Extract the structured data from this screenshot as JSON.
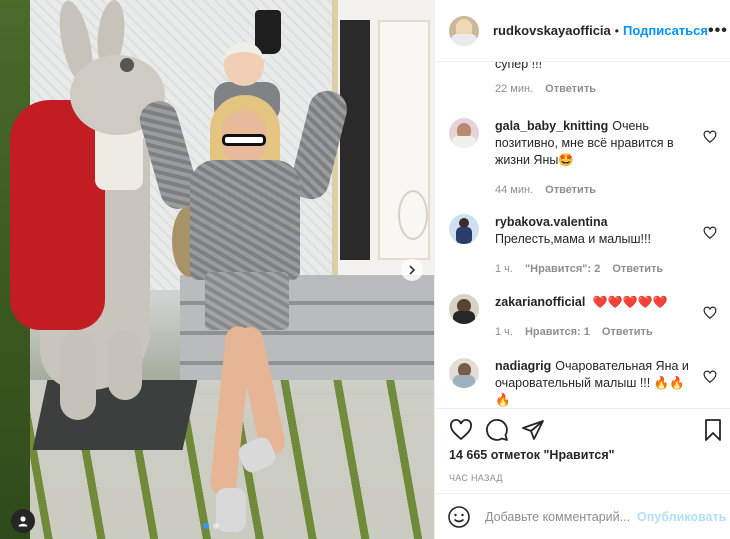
{
  "post": {
    "image_alt": "",
    "carousel": {
      "dots": 2,
      "active": 0
    },
    "icons": {
      "next": "chevron-right-icon",
      "tag": "user-tag-icon"
    }
  },
  "header": {
    "username": "rudkovskayaofficia",
    "separator": "•",
    "follow_label": "Подписаться",
    "more_label": "•••"
  },
  "comments": [
    {
      "user": "",
      "text": "супер !!!",
      "time": "22 мин.",
      "likes": "",
      "reply": "Ответить",
      "has_avatar": false
    },
    {
      "user": "gala_baby_knitting",
      "text": "Очень позитивно, мне всё нравится в жизни Яны🤩",
      "time": "44 мин.",
      "likes": "",
      "reply": "Ответить",
      "has_avatar": true
    },
    {
      "user": "rybakova.valentina",
      "text": "Прелесть,мама и малыш!!!",
      "time": "1 ч.",
      "likes": "\"Нравится\": 2",
      "reply": "Ответить",
      "has_avatar": true
    },
    {
      "user": "zakarianofficial",
      "text": "❤️❤️❤️❤️❤️",
      "time": "1 ч.",
      "likes": "Нравится: 1",
      "reply": "Ответить",
      "has_avatar": true
    },
    {
      "user": "nadiagrig",
      "text": "Очаровательная Яна и очаровательный малыш !!! 🔥🔥🔥",
      "time": "",
      "likes": "",
      "reply": "",
      "has_avatar": true
    }
  ],
  "actions": {
    "icons": [
      "heart-icon",
      "comment-icon",
      "share-icon",
      "bookmark-icon"
    ]
  },
  "likes_text": "14 665 отметок \"Нравится\"",
  "time_ago": "ЧАС НАЗАД",
  "composer": {
    "placeholder": "Добавьте комментарий...",
    "publish_label": "Опубликовать"
  },
  "colors": {
    "accent": "#0095f6",
    "publish_disabled": "#b2dffc",
    "muted": "#8e8e8e",
    "text": "#262626"
  }
}
